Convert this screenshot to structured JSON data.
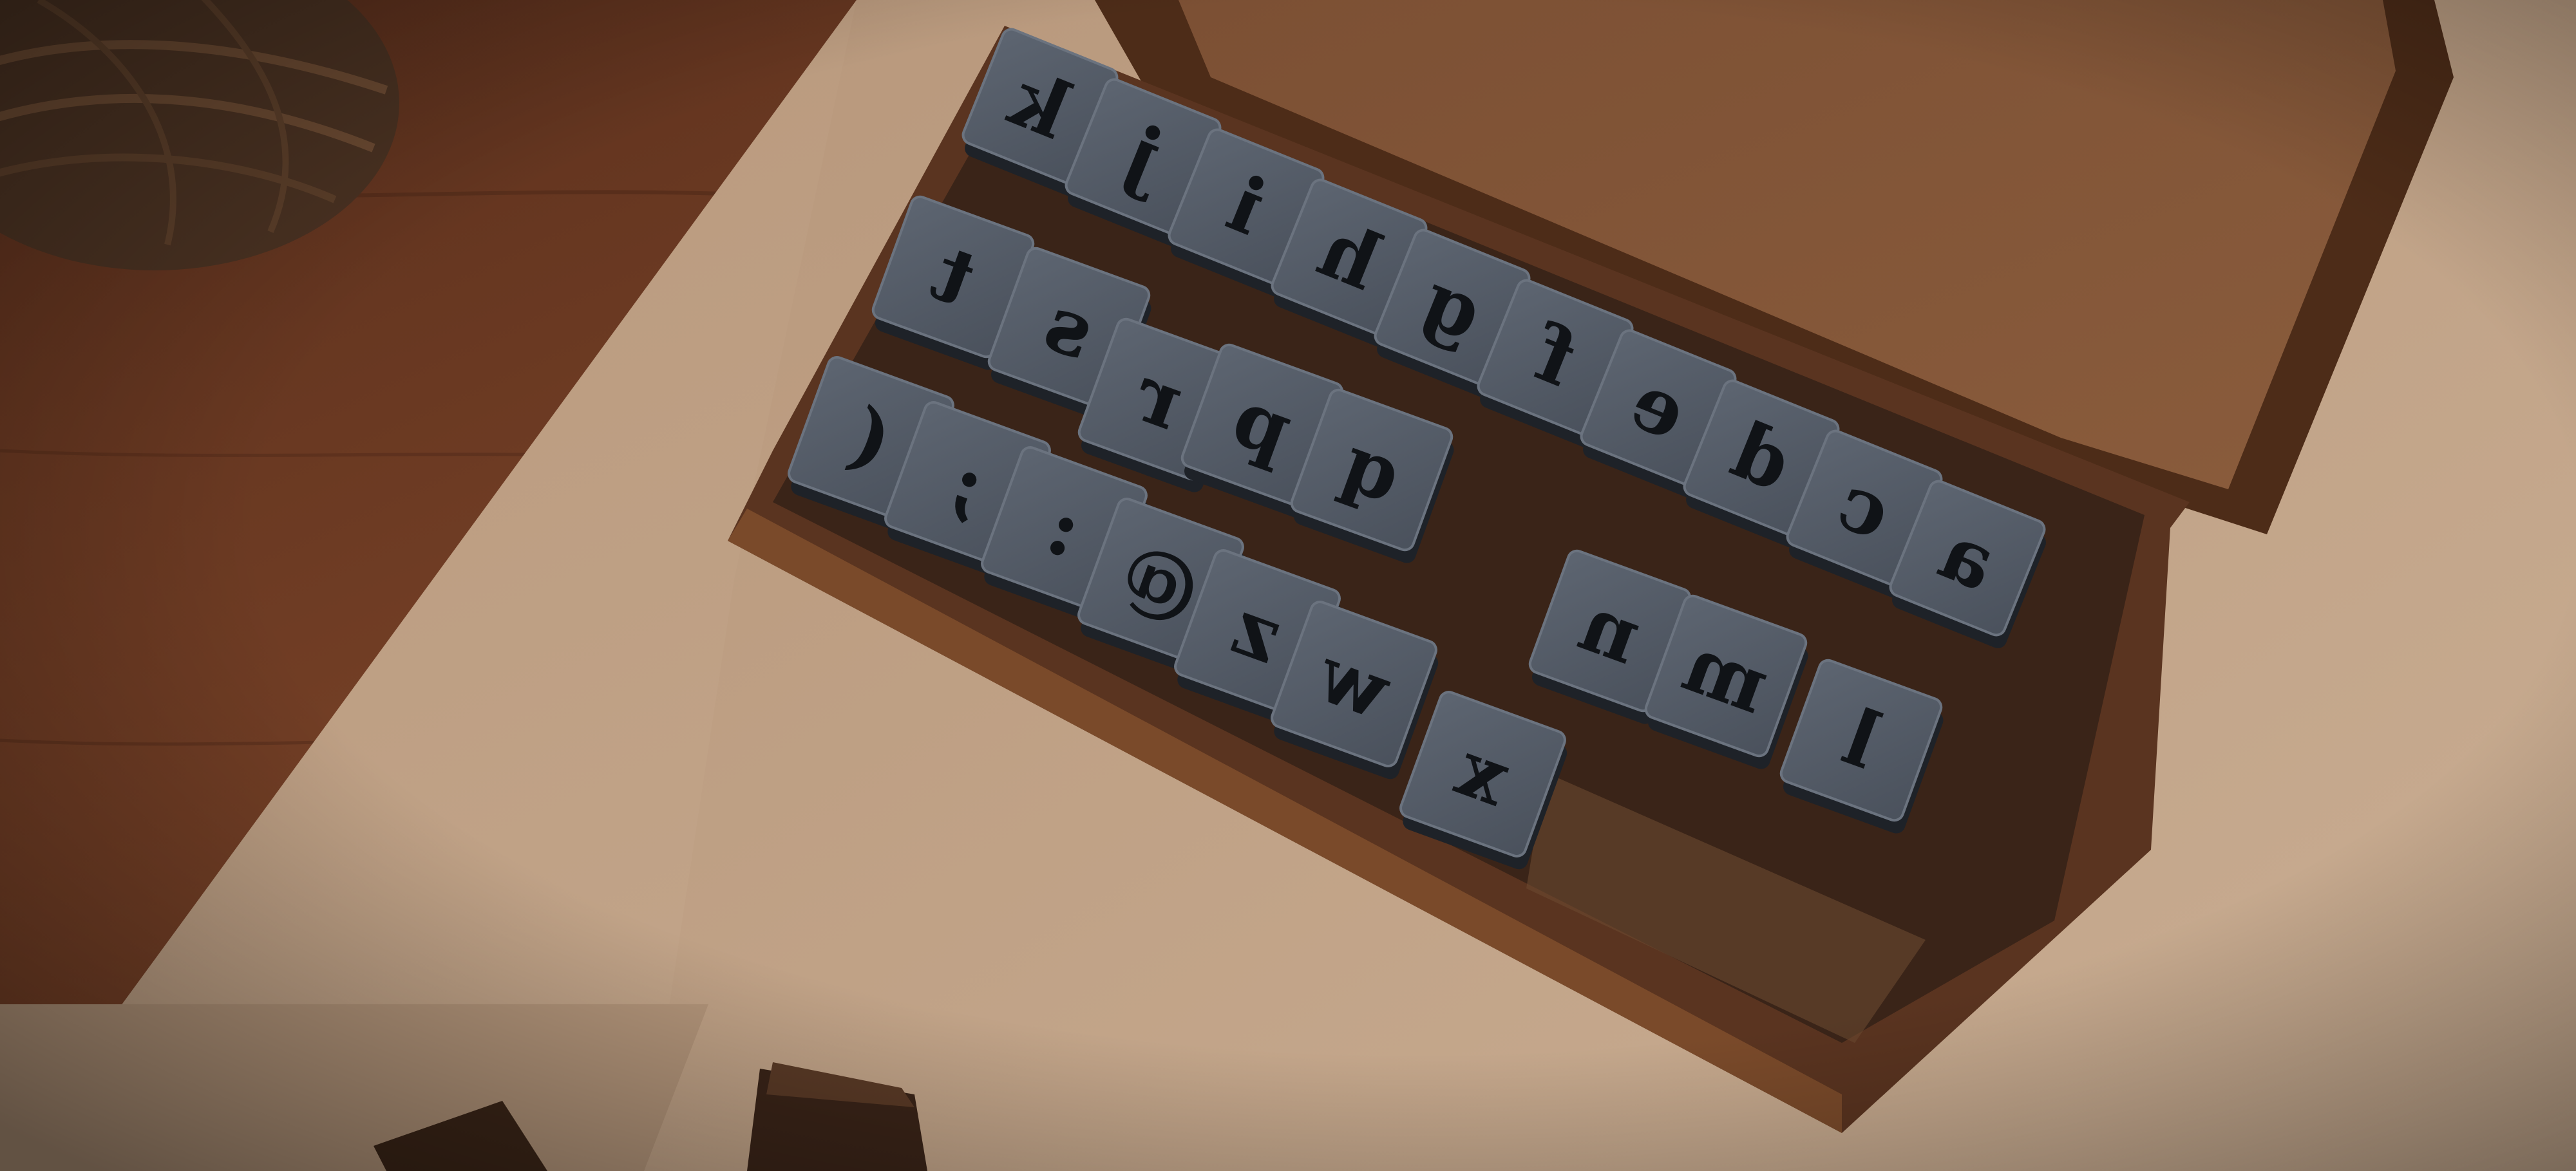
{
  "scene": {
    "subject": "wooden-box-of-letter-stamps",
    "colors": {
      "wood_table": "#6b3a22",
      "kraft_paper": "#c2a58a",
      "box_wood": "#6a4024",
      "box_interior": "#3a2418",
      "stamp_face": "#525a66",
      "stamp_letter": "#101317"
    }
  },
  "stamps": {
    "row1": [
      "k",
      "j",
      "i",
      "h",
      "g",
      "f",
      "e",
      "d",
      "c",
      "a"
    ],
    "row2": [
      "t",
      "s",
      "r",
      "p",
      "q",
      "n",
      "m",
      "l"
    ],
    "row3": [
      "(",
      ";",
      ":",
      "@",
      "z",
      "w",
      "x"
    ]
  }
}
